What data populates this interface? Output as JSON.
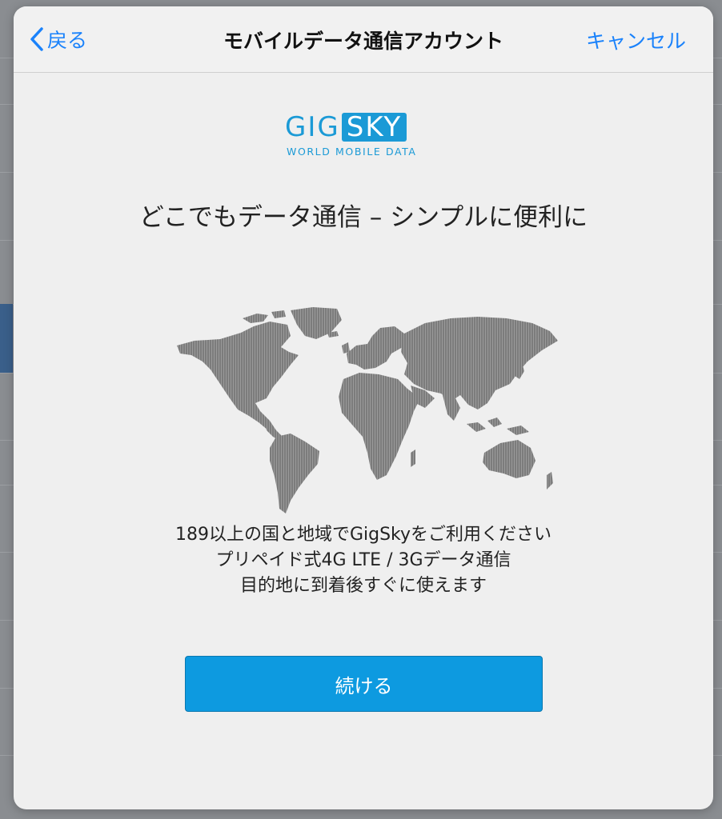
{
  "navbar": {
    "back_label": "戻る",
    "title": "モバイルデータ通信アカウント",
    "cancel_label": "キャンセル"
  },
  "logo": {
    "brand_part1": "GIG",
    "brand_part2": "SKY",
    "tagline": "WORLD MOBILE DATA"
  },
  "headline": "どこでもデータ通信 – シンプルに便利に",
  "description": {
    "line1": "189以上の国と地域でGigSkyをご利用ください",
    "line2": "プリペイド式4G LTE / 3Gデータ通信",
    "line3": "目的地に到着後すぐに使えます"
  },
  "continue_button": "続ける",
  "icons": {
    "back": "chevron-left-icon",
    "map": "world-map-icon"
  },
  "colors": {
    "accent": "#1a82fb",
    "brand": "#1b9ad6",
    "button": "#0d9ae0",
    "sheet_bg": "#efefef"
  }
}
